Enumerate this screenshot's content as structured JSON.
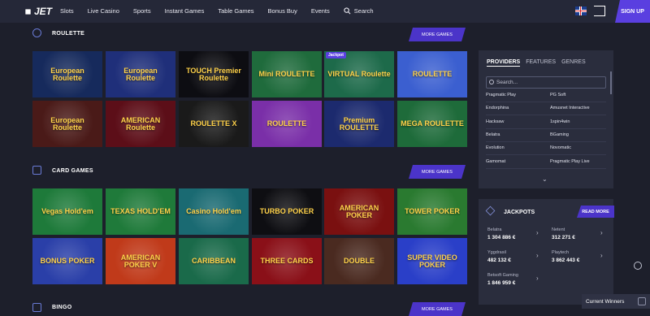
{
  "header": {
    "logo": "JET",
    "nav": [
      "Slots",
      "Live Casino",
      "Sports",
      "Instant Games",
      "Table Games",
      "Bonus Buy",
      "Events"
    ],
    "search_label": "Search",
    "signup_label": "SIGN UP"
  },
  "sections": [
    {
      "title": "ROULETTE",
      "more_label": "MORE GAMES",
      "tiles": [
        {
          "label": "European Roulette",
          "bg": "#162a5c"
        },
        {
          "label": "European Roulette",
          "bg": "#1f2f7a"
        },
        {
          "label": "TOUCH Premier Roulette",
          "bg": "#0d0d12"
        },
        {
          "label": "Mini ROULETTE",
          "bg": "#1f6b3c"
        },
        {
          "label": "VIRTUAL Roulette",
          "bg": "#1d6a4a",
          "tag": "Jackpot"
        },
        {
          "label": "ROULETTE",
          "bg": "#3b5fd0"
        },
        {
          "label": "European Roulette",
          "bg": "#4a1a18"
        },
        {
          "label": "AMERICAN Roulette",
          "bg": "#5c0e18"
        },
        {
          "label": "ROULETTE X",
          "bg": "#1a1a1a"
        },
        {
          "label": "ROULETTE",
          "bg": "#7a2fa8"
        },
        {
          "label": "Premium ROULETTE",
          "bg": "#1c2a6e"
        },
        {
          "label": "MEGA ROULETTE",
          "bg": "#1e6b3a"
        }
      ]
    },
    {
      "title": "CARD GAMES",
      "more_label": "MORE GAMES",
      "tiles": [
        {
          "label": "Vegas Hold'em",
          "bg": "#1e7a3a"
        },
        {
          "label": "TEXAS HOLD'EM",
          "bg": "#1f7a3a"
        },
        {
          "label": "Casino Hold'em",
          "bg": "#1a6a72"
        },
        {
          "label": "TURBO POKER",
          "bg": "#0e0e12"
        },
        {
          "label": "AMERICAN POKER",
          "bg": "#7a1010"
        },
        {
          "label": "TOWER POKER",
          "bg": "#2a7a30"
        },
        {
          "label": "BONUS POKER",
          "bg": "#2a3fa8"
        },
        {
          "label": "AMERICAN POKER V",
          "bg": "#c03a1a"
        },
        {
          "label": "CARIBBEAN",
          "bg": "#1a6a4a"
        },
        {
          "label": "THREE CARDS",
          "bg": "#8a1018"
        },
        {
          "label": "DOUBLE",
          "bg": "#4a2a20"
        },
        {
          "label": "SUPER VIDEO POKER",
          "bg": "#2a3fc8"
        }
      ]
    },
    {
      "title": "BINGO",
      "more_label": "MORE GAMES"
    }
  ],
  "providers_panel": {
    "tabs": [
      "PROVIDERS",
      "FEATURES",
      "GENRES"
    ],
    "search_placeholder": "Search...",
    "left": [
      "Pragmatic Play",
      "Endorphina",
      "Hacksaw",
      "Belatra",
      "Evolution",
      "Gamomat"
    ],
    "right": [
      "PG Soft",
      "Amusnet Interactive",
      "1spin4win",
      "BGaming",
      "Novomatic",
      "Pragmatic Play Live"
    ]
  },
  "jackpots": {
    "title": "JACKPOTS",
    "read_more": "READ MORE",
    "items": [
      {
        "name": "Belatra",
        "value": "1 304 886 €"
      },
      {
        "name": "Netent",
        "value": "312 271 €"
      },
      {
        "name": "Yggdrasil",
        "value": "482 132 €"
      },
      {
        "name": "Playtech",
        "value": "3 862 443 €"
      },
      {
        "name": "Betsoft Gaming",
        "value": "1 846 959 €"
      }
    ]
  },
  "widgets": {
    "current_winners": "Current Winners"
  }
}
